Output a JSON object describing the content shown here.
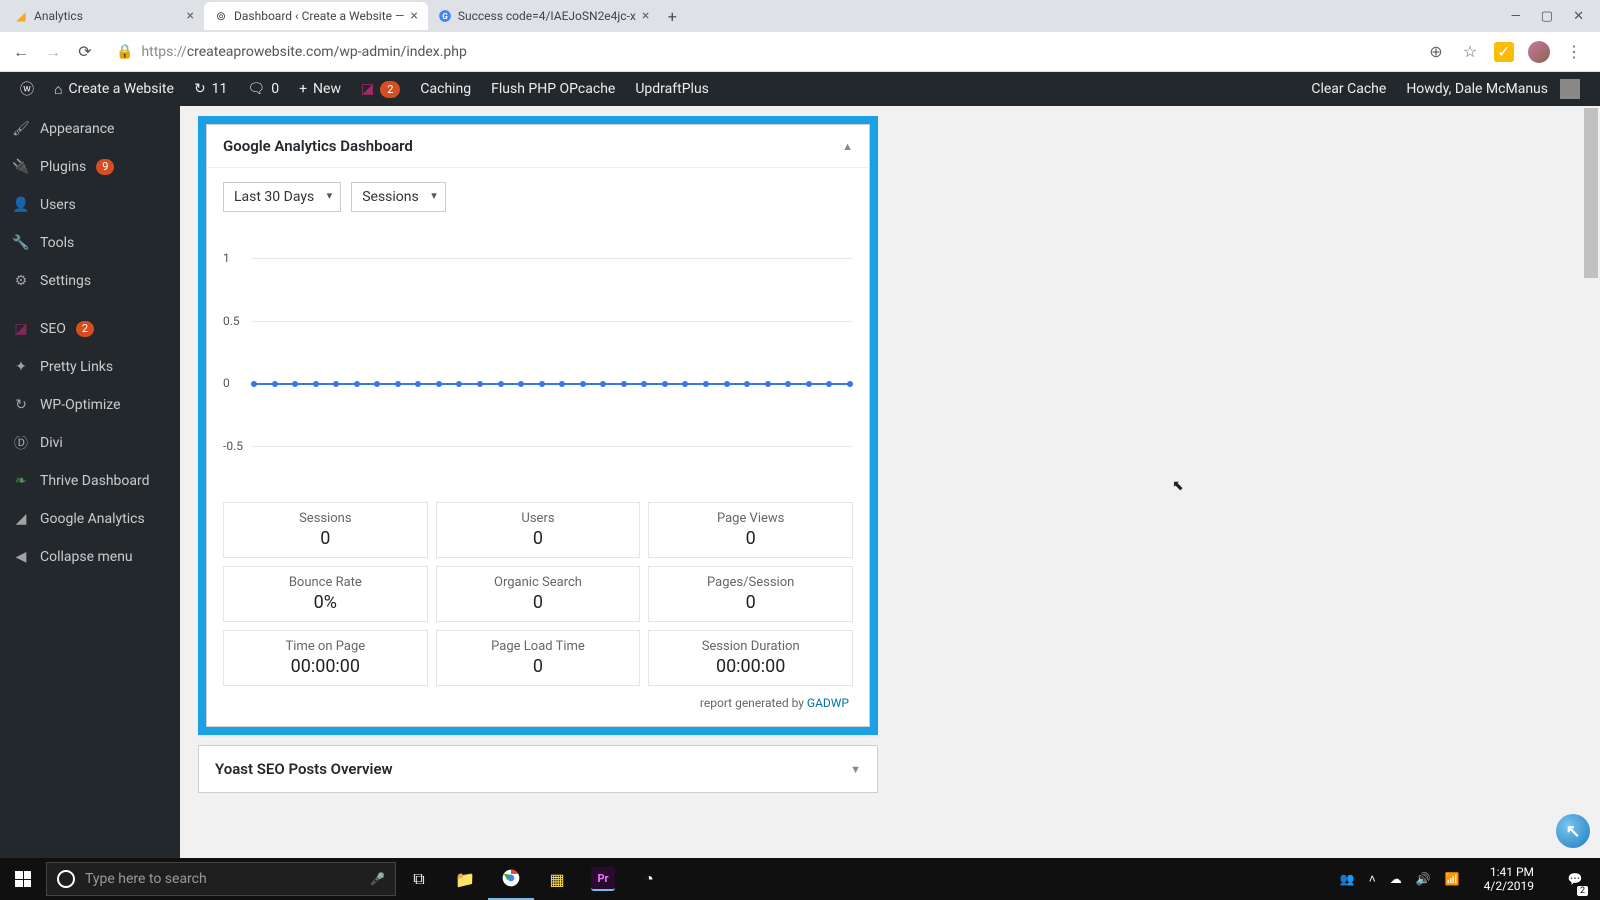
{
  "browser": {
    "tabs": [
      {
        "title": "Analytics",
        "favicon": "analytics"
      },
      {
        "title": "Dashboard ‹ Create a Website —",
        "favicon": "wp",
        "active": true
      },
      {
        "title": "Success code=4/IAEJoSN2e4jc-x",
        "favicon": "google"
      }
    ],
    "url_proto": "https://",
    "url_rest": "createaprowebsite.com/wp-admin/index.php"
  },
  "wpbar": {
    "site_name": "Create a Website",
    "updates": "11",
    "comments": "0",
    "new_label": "New",
    "yoast_badge": "2",
    "caching": "Caching",
    "flush": "Flush PHP OPcache",
    "updraft": "UpdraftPlus",
    "clear": "Clear Cache",
    "howdy": "Howdy, Dale McManus"
  },
  "sidebar": {
    "items": [
      {
        "label": "Appearance",
        "icon": "brush"
      },
      {
        "label": "Plugins",
        "icon": "plug",
        "badge": "9"
      },
      {
        "label": "Users",
        "icon": "user"
      },
      {
        "label": "Tools",
        "icon": "wrench"
      },
      {
        "label": "Settings",
        "icon": "sliders"
      },
      {
        "label": "SEO",
        "icon": "seo",
        "badge": "2"
      },
      {
        "label": "Pretty Links",
        "icon": "star"
      },
      {
        "label": "WP-Optimize",
        "icon": "cycle"
      },
      {
        "label": "Divi",
        "icon": "divi"
      },
      {
        "label": "Thrive Dashboard",
        "icon": "leaf"
      },
      {
        "label": "Google Analytics",
        "icon": "chart"
      },
      {
        "label": "Collapse menu",
        "icon": "collapse"
      }
    ]
  },
  "ga_panel": {
    "title": "Google Analytics Dashboard",
    "range": "Last 30 Days",
    "metric": "Sessions",
    "report_prefix": "report generated by ",
    "report_link": "GADWP"
  },
  "chart_data": {
    "type": "line",
    "title": "",
    "xlabel": "",
    "ylabel": "",
    "ylim": [
      -0.5,
      1.0
    ],
    "yticks": [
      1.0,
      0.5,
      0.0,
      -0.5
    ],
    "x": [
      1,
      2,
      3,
      4,
      5,
      6,
      7,
      8,
      9,
      10,
      11,
      12,
      13,
      14,
      15,
      16,
      17,
      18,
      19,
      20,
      21,
      22,
      23,
      24,
      25,
      26,
      27,
      28,
      29,
      30
    ],
    "series": [
      {
        "name": "Sessions",
        "values": [
          0,
          0,
          0,
          0,
          0,
          0,
          0,
          0,
          0,
          0,
          0,
          0,
          0,
          0,
          0,
          0,
          0,
          0,
          0,
          0,
          0,
          0,
          0,
          0,
          0,
          0,
          0,
          0,
          0,
          0
        ]
      }
    ]
  },
  "stats": [
    {
      "label": "Sessions",
      "value": "0"
    },
    {
      "label": "Users",
      "value": "0"
    },
    {
      "label": "Page Views",
      "value": "0"
    },
    {
      "label": "Bounce Rate",
      "value": "0%"
    },
    {
      "label": "Organic Search",
      "value": "0"
    },
    {
      "label": "Pages/Session",
      "value": "0"
    },
    {
      "label": "Time on Page",
      "value": "00:00:00"
    },
    {
      "label": "Page Load Time",
      "value": "0"
    },
    {
      "label": "Session Duration",
      "value": "00:00:00"
    }
  ],
  "yoast": {
    "title": "Yoast SEO Posts Overview"
  },
  "taskbar": {
    "search_placeholder": "Type here to search",
    "time": "1:41 PM",
    "date": "4/2/2019",
    "notif_count": "2"
  }
}
